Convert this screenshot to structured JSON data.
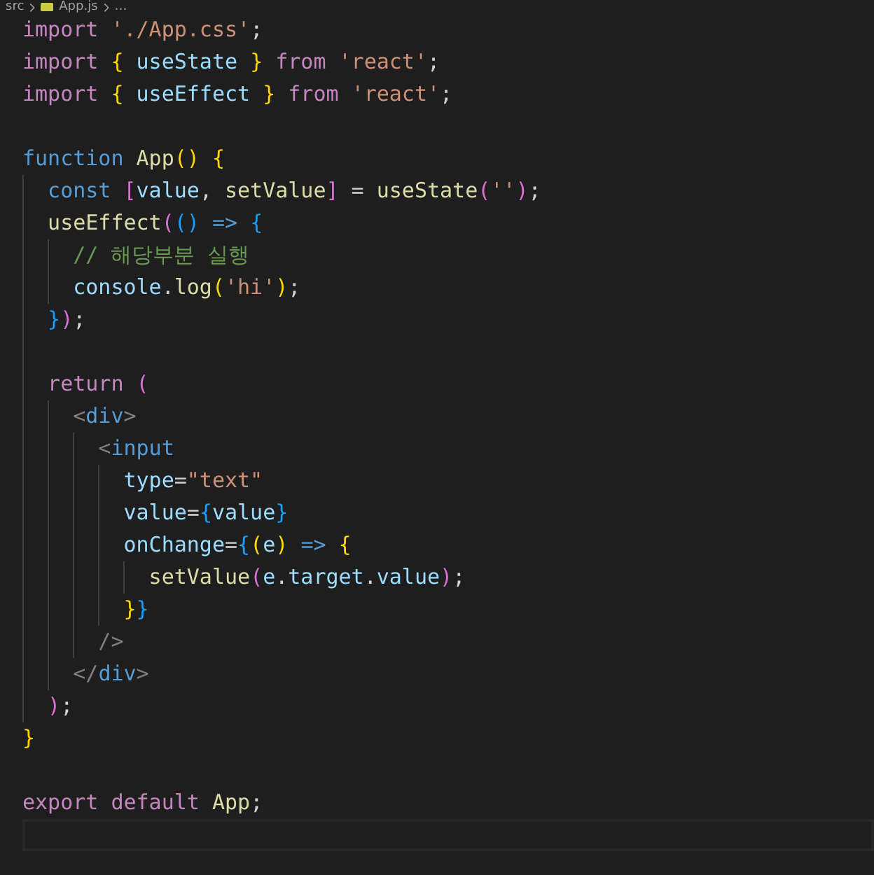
{
  "breadcrumb": [
    {
      "kind": "folder",
      "text": "src"
    },
    {
      "kind": "file",
      "text": "App.js"
    },
    {
      "kind": "more",
      "text": "…"
    }
  ],
  "lines": [
    {
      "kind": "code",
      "tokens": [
        {
          "kind": "kw",
          "text": "import "
        },
        {
          "kind": "str",
          "text": "'./App.css'"
        },
        {
          "kind": "punc",
          "text": ";"
        }
      ]
    },
    {
      "kind": "code",
      "tokens": [
        {
          "kind": "kw",
          "text": "import "
        },
        {
          "kind": "b1",
          "text": "{"
        },
        {
          "kind": "var",
          "text": " useState "
        },
        {
          "kind": "b1",
          "text": "}"
        },
        {
          "kind": "kw",
          "text": " from "
        },
        {
          "kind": "str",
          "text": "'react'"
        },
        {
          "kind": "punc",
          "text": ";"
        }
      ]
    },
    {
      "kind": "code",
      "tokens": [
        {
          "kind": "kw",
          "text": "import "
        },
        {
          "kind": "b1",
          "text": "{"
        },
        {
          "kind": "var",
          "text": " useEffect "
        },
        {
          "kind": "b1",
          "text": "}"
        },
        {
          "kind": "kw",
          "text": " from "
        },
        {
          "kind": "str",
          "text": "'react'"
        },
        {
          "kind": "punc",
          "text": ";"
        }
      ]
    },
    {
      "kind": "blank"
    },
    {
      "kind": "code",
      "tokens": [
        {
          "kind": "storage",
          "text": "function "
        },
        {
          "kind": "fn",
          "text": "App"
        },
        {
          "kind": "b1",
          "text": "() {"
        }
      ]
    },
    {
      "kind": "code",
      "tokens": [
        {
          "kind": "storage",
          "text": "  const "
        },
        {
          "kind": "b2",
          "text": "["
        },
        {
          "kind": "var",
          "text": "value"
        },
        {
          "kind": "punc",
          "text": ", "
        },
        {
          "kind": "fn",
          "text": "setValue"
        },
        {
          "kind": "b2",
          "text": "]"
        },
        {
          "kind": "punc",
          "text": " = "
        },
        {
          "kind": "fn",
          "text": "useState"
        },
        {
          "kind": "b2",
          "text": "("
        },
        {
          "kind": "str",
          "text": "''"
        },
        {
          "kind": "b2",
          "text": ")"
        },
        {
          "kind": "punc",
          "text": ";"
        }
      ]
    },
    {
      "kind": "code",
      "tokens": [
        {
          "kind": "fn",
          "text": "  useEffect"
        },
        {
          "kind": "b2",
          "text": "("
        },
        {
          "kind": "b3",
          "text": "() "
        },
        {
          "kind": "storage",
          "text": "=> "
        },
        {
          "kind": "b3",
          "text": "{"
        }
      ]
    },
    {
      "kind": "code",
      "tokens": [
        {
          "kind": "comment",
          "text": "    // 해당부분 실행"
        }
      ]
    },
    {
      "kind": "code",
      "tokens": [
        {
          "kind": "var",
          "text": "    console"
        },
        {
          "kind": "punc",
          "text": "."
        },
        {
          "kind": "fn",
          "text": "log"
        },
        {
          "kind": "b1",
          "text": "("
        },
        {
          "kind": "str",
          "text": "'hi'"
        },
        {
          "kind": "b1",
          "text": ")"
        },
        {
          "kind": "punc",
          "text": ";"
        }
      ]
    },
    {
      "kind": "code",
      "tokens": [
        {
          "kind": "b3",
          "text": "  }"
        },
        {
          "kind": "b2",
          "text": ")"
        },
        {
          "kind": "punc",
          "text": ";"
        }
      ]
    },
    {
      "kind": "blank"
    },
    {
      "kind": "code",
      "tokens": [
        {
          "kind": "kw",
          "text": "  return "
        },
        {
          "kind": "b2",
          "text": "("
        }
      ]
    },
    {
      "kind": "code",
      "tokens": [
        {
          "kind": "tag",
          "text": "    <"
        },
        {
          "kind": "storage",
          "text": "div"
        },
        {
          "kind": "tag",
          "text": ">"
        }
      ]
    },
    {
      "kind": "code",
      "tokens": [
        {
          "kind": "tag",
          "text": "      <"
        },
        {
          "kind": "storage",
          "text": "input"
        }
      ]
    },
    {
      "kind": "code",
      "tokens": [
        {
          "kind": "attr",
          "text": "        type"
        },
        {
          "kind": "punc",
          "text": "="
        },
        {
          "kind": "str",
          "text": "\"text\""
        }
      ]
    },
    {
      "kind": "code",
      "tokens": [
        {
          "kind": "attr",
          "text": "        value"
        },
        {
          "kind": "punc",
          "text": "="
        },
        {
          "kind": "b3",
          "text": "{"
        },
        {
          "kind": "var",
          "text": "value"
        },
        {
          "kind": "b3",
          "text": "}"
        }
      ]
    },
    {
      "kind": "code",
      "tokens": [
        {
          "kind": "attr",
          "text": "        onChange"
        },
        {
          "kind": "punc",
          "text": "="
        },
        {
          "kind": "b3",
          "text": "{"
        },
        {
          "kind": "b1",
          "text": "("
        },
        {
          "kind": "var",
          "text": "e"
        },
        {
          "kind": "b1",
          "text": ") "
        },
        {
          "kind": "storage",
          "text": "=> "
        },
        {
          "kind": "b1",
          "text": "{"
        }
      ]
    },
    {
      "kind": "code",
      "tokens": [
        {
          "kind": "fn",
          "text": "          setValue"
        },
        {
          "kind": "b2",
          "text": "("
        },
        {
          "kind": "var",
          "text": "e"
        },
        {
          "kind": "punc",
          "text": "."
        },
        {
          "kind": "var",
          "text": "target"
        },
        {
          "kind": "punc",
          "text": "."
        },
        {
          "kind": "var",
          "text": "value"
        },
        {
          "kind": "b2",
          "text": ")"
        },
        {
          "kind": "punc",
          "text": ";"
        }
      ]
    },
    {
      "kind": "code",
      "tokens": [
        {
          "kind": "b1",
          "text": "        }"
        },
        {
          "kind": "b3",
          "text": "}"
        }
      ]
    },
    {
      "kind": "code",
      "tokens": [
        {
          "kind": "tag",
          "text": "      />"
        }
      ]
    },
    {
      "kind": "code",
      "tokens": [
        {
          "kind": "tag",
          "text": "    </"
        },
        {
          "kind": "storage",
          "text": "div"
        },
        {
          "kind": "tag",
          "text": ">"
        }
      ]
    },
    {
      "kind": "code",
      "tokens": [
        {
          "kind": "b2",
          "text": "  )"
        },
        {
          "kind": "punc",
          "text": ";"
        }
      ]
    },
    {
      "kind": "code",
      "tokens": [
        {
          "kind": "b1",
          "text": "}"
        }
      ]
    },
    {
      "kind": "blank"
    },
    {
      "kind": "code",
      "tokens": [
        {
          "kind": "kw",
          "text": "export default "
        },
        {
          "kind": "fn",
          "text": "App"
        },
        {
          "kind": "punc",
          "text": ";"
        }
      ]
    },
    {
      "kind": "blank",
      "current": true
    }
  ]
}
